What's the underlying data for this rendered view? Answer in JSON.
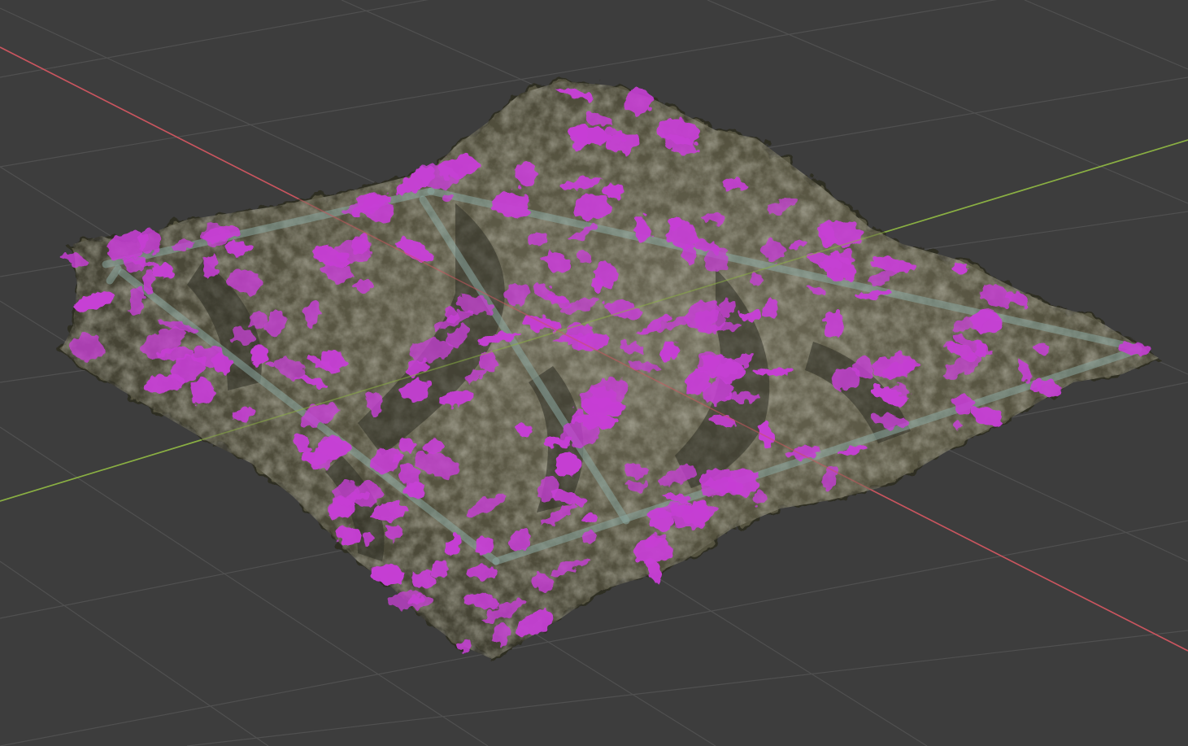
{
  "viewport": {
    "background_color": "#3d3d3d",
    "grid_line_color": "#505050",
    "x_axis_color": "#c9565f",
    "y_axis_color": "#8bb044",
    "mesh_base_color": "#55523f",
    "mesh_dark_color": "#2e2d24",
    "mesh_light_color": "#8a8670",
    "missing_texture_color": "#c63fd4",
    "frame_color": "#8aa7a0"
  }
}
